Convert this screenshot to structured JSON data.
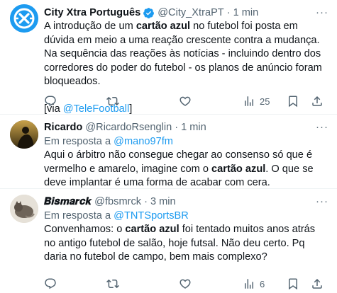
{
  "tweets": [
    {
      "name": "City Xtra Português",
      "handle": "@City_XtraPT",
      "dot": "·",
      "time": "1 min",
      "more": "···",
      "body_a": "A introdução de um ",
      "body_bold": "cartão azul",
      "body_b": " no futebol foi posta em dúvida em meio a uma reação crescente contra a mudança. Na sequência das reações às notícias - incluindo dentro dos corredores do poder do futebol - os planos de anúncio foram bloqueados.",
      "via_prefix": "[via ",
      "via_link": "@TeleFootball",
      "via_suffix": "]",
      "counts": {
        "reply": "",
        "retweet": "",
        "like": "",
        "views": "25"
      }
    },
    {
      "name": "Ricardo",
      "handle": "@RicardoRsenglin",
      "dot": "·",
      "time": "1 min",
      "more": "···",
      "replying_prefix": "Em resposta a ",
      "replying_to": "@mano97fm",
      "body_a": "Aqui o árbitro não consegue chegar ao consenso só que é  vermelho e amarelo, imagine com o ",
      "body_bold": "cartão azul",
      "body_b": ".  O que se deve implantar é uma forma de acabar com cera.",
      "counts": {
        "reply": "",
        "retweet": "",
        "like": "",
        "views": ""
      }
    },
    {
      "name": "𝑩𝒊𝒔𝒎𝒂𝒓𝒄𝒌",
      "handle": "@fbsmrck",
      "dot": "·",
      "time": "3 min",
      "more": "···",
      "replying_prefix": "Em resposta a ",
      "replying_to": "@TNTSportsBR",
      "body_a": "Convenhamos: o ",
      "body_bold": "cartão azul",
      "body_b": " foi tentado muitos anos atrás no antigo futebol de salão, hoje futsal. Não deu certo. Pq daria no futebol de campo, bem mais complexo?",
      "counts": {
        "reply": "",
        "retweet": "",
        "like": "",
        "views": "6"
      }
    }
  ],
  "colors": {
    "link": "#1d9bf0",
    "muted": "#536471",
    "verified": "#1d9bf0",
    "text": "#0f1419"
  },
  "icons": [
    "verified-badge-icon",
    "more-icon",
    "reply-icon",
    "retweet-icon",
    "like-icon",
    "views-icon",
    "bookmark-icon",
    "share-icon"
  ]
}
